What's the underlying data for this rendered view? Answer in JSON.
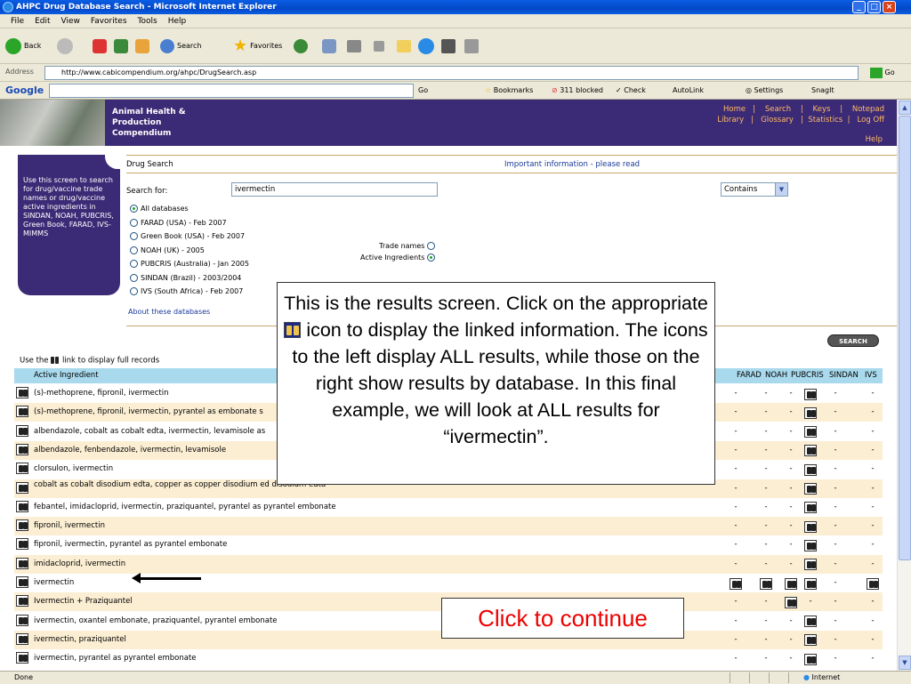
{
  "window": {
    "title": "AHPC Drug Database Search - Microsoft Internet Explorer"
  },
  "menu": [
    "File",
    "Edit",
    "View",
    "Favorites",
    "Tools",
    "Help"
  ],
  "toolbar": {
    "back": "Back",
    "search": "Search",
    "favorites": "Favorites"
  },
  "address": {
    "label": "Address",
    "url": "http://www.cabicompendium.org/ahpc/DrugSearch.asp",
    "go": "Go"
  },
  "google": {
    "logo": "Google",
    "go": "Go",
    "bookmarks": "Bookmarks",
    "blocked": "311 blocked",
    "check": "Check",
    "autolink": "AutoLink",
    "settings": "Settings",
    "snagit": "SnagIt"
  },
  "banner": {
    "brand": "Animal Health &\nProduction\nCompendium",
    "links": "Home   |    Search    |    Keys    |    Notepad\nLibrary   |   Glossary   |  Statistics  |   Log Off",
    "help": "Help"
  },
  "left_help": "Use this screen to search for drug/vaccine trade names or drug/vaccine active ingredients in SINDAN, NOAH, PUBCRIS, Green Book, FARAD, IVS-MIMMS",
  "form": {
    "title": "Drug Search",
    "important": "Important information - please read",
    "search_label": "Search for:",
    "search_value": "ivermectin",
    "match": "Contains",
    "databases": [
      {
        "label": "All databases",
        "selected": true
      },
      {
        "label": "FARAD (USA) - Feb 2007",
        "selected": false
      },
      {
        "label": "Green Book (USA) - Feb 2007",
        "selected": false
      },
      {
        "label": "NOAH (UK) - 2005",
        "selected": false
      },
      {
        "label": "PUBCRIS (Australia) - Jan 2005",
        "selected": false
      },
      {
        "label": "SINDAN (Brazil) - 2003/2004",
        "selected": false
      },
      {
        "label": "IVS (South Africa) - Feb 2007",
        "selected": false
      }
    ],
    "trade_names": "Trade names",
    "active_ingredients": "Active Ingredients",
    "about": "About these databases",
    "search_button": "SEARCH"
  },
  "results": {
    "use_link_before": "Use the",
    "use_link_after": "link to display full records",
    "headers": {
      "ingredient": "Active Ingredient",
      "farad": "FARAD",
      "noah": "NOAH",
      "pubcris": "PUBCRIS",
      "sindan": "SINDAN",
      "ivs": "IVS"
    },
    "rows": [
      {
        "ingredient": "(s)-methoprene, fipronil, ivermectin",
        "cols": [
          "-",
          "-",
          "-",
          "B",
          "-",
          "-"
        ]
      },
      {
        "ingredient": "(s)-methoprene, fipronil, ivermectin, pyrantel as embonate s",
        "cols": [
          "-",
          "-",
          "-",
          "B",
          "-",
          "-"
        ]
      },
      {
        "ingredient": "albendazole, cobalt as cobalt edta, ivermectin, levamisole as",
        "cols": [
          "-",
          "-",
          "-",
          "B",
          "-",
          "-"
        ]
      },
      {
        "ingredient": "albendazole, fenbendazole, ivermectin, levamisole",
        "cols": [
          "-",
          "-",
          "-",
          "B",
          "-",
          "-"
        ]
      },
      {
        "ingredient": "clorsulon, ivermectin",
        "cols": [
          "-",
          "-",
          "-",
          "B",
          "-",
          "-"
        ]
      },
      {
        "ingredient": "cobalt as cobalt disodium edta, copper as copper disodium ed disodium edta",
        "cols": [
          "-",
          "-",
          "-",
          "B",
          "-",
          "-"
        ]
      },
      {
        "ingredient": "febantel, imidacloprid, ivermectin, praziquantel, pyrantel as pyrantel embonate",
        "cols": [
          "-",
          "-",
          "-",
          "B",
          "-",
          "-"
        ]
      },
      {
        "ingredient": "fipronil, ivermectin",
        "cols": [
          "-",
          "-",
          "-",
          "B",
          "-",
          "-"
        ]
      },
      {
        "ingredient": "fipronil, ivermectin, pyrantel as pyrantel embonate",
        "cols": [
          "-",
          "-",
          "-",
          "B",
          "-",
          "-"
        ]
      },
      {
        "ingredient": "imidacloprid, ivermectin",
        "cols": [
          "-",
          "-",
          "-",
          "B",
          "-",
          "-"
        ]
      },
      {
        "ingredient": "ivermectin",
        "cols": [
          "B",
          "B",
          "B",
          "B",
          "-",
          "B"
        ]
      },
      {
        "ingredient": "Ivermectin + Praziquantel",
        "cols": [
          "-",
          "-",
          "B",
          "-",
          "-",
          "-"
        ]
      },
      {
        "ingredient": "ivermectin, oxantel embonate, praziquantel, pyrantel embonate",
        "cols": [
          "-",
          "-",
          "-",
          "B",
          "-",
          "-"
        ]
      },
      {
        "ingredient": "ivermectin, praziquantel",
        "cols": [
          "-",
          "-",
          "-",
          "B",
          "-",
          "-"
        ]
      },
      {
        "ingredient": "ivermectin, pyrantel as pyrantel embonate",
        "cols": [
          "-",
          "-",
          "-",
          "B",
          "-",
          "-"
        ]
      }
    ]
  },
  "callout": {
    "part1": "This is the results screen.  Click on the appropriate",
    "part2": "icon to display the linked information.  The icons to the left display ALL results, while those on the right show results by database.  In this final example, we will look at ALL results for “ivermectin”."
  },
  "continue": "Click to continue",
  "status": {
    "left": "Done",
    "zone": "Internet"
  }
}
